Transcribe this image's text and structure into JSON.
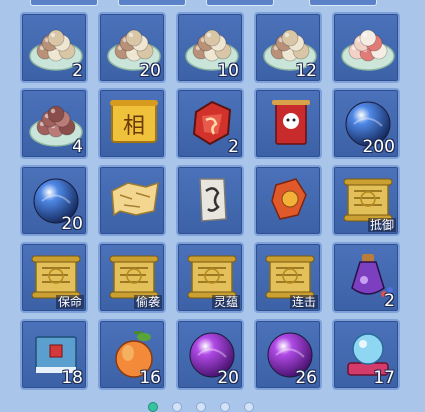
{
  "inventory": {
    "rows": [
      [
        {
          "name": "rice-balls-icon",
          "count": "2",
          "tag": ""
        },
        {
          "name": "rice-balls-icon",
          "count": "20",
          "tag": ""
        },
        {
          "name": "rice-balls-icon",
          "count": "10",
          "tag": ""
        },
        {
          "name": "rice-balls-icon",
          "count": "12",
          "tag": ""
        },
        {
          "name": "pink-rice-balls-icon",
          "count": "",
          "tag": ""
        }
      ],
      [
        {
          "name": "red-rice-balls-icon",
          "count": "4",
          "tag": ""
        },
        {
          "name": "golden-scroll-icon",
          "count": "",
          "tag": "",
          "glyph": "相"
        },
        {
          "name": "red-gem-icon",
          "count": "2",
          "tag": ""
        },
        {
          "name": "red-banner-icon",
          "count": "",
          "tag": ""
        },
        {
          "name": "blue-orb-icon",
          "count": "200",
          "tag": ""
        }
      ],
      [
        {
          "name": "blue-orb-icon",
          "count": "20",
          "tag": ""
        },
        {
          "name": "map-fragment-icon",
          "count": "",
          "tag": ""
        },
        {
          "name": "talisman-icon",
          "count": "",
          "tag": ""
        },
        {
          "name": "red-ornament-icon",
          "count": "",
          "tag": ""
        },
        {
          "name": "skill-scroll-icon",
          "count": "",
          "tag": "抵御"
        }
      ],
      [
        {
          "name": "skill-scroll-icon",
          "count": "",
          "tag": "保命"
        },
        {
          "name": "skill-scroll-icon",
          "count": "",
          "tag": "偷袭"
        },
        {
          "name": "skill-scroll-icon",
          "count": "",
          "tag": "灵蕴"
        },
        {
          "name": "skill-scroll-icon",
          "count": "",
          "tag": "连击"
        },
        {
          "name": "potion-bottle-icon",
          "count": "2",
          "tag": ""
        }
      ],
      [
        {
          "name": "book-icon",
          "count": "18",
          "tag": ""
        },
        {
          "name": "peach-icon",
          "count": "16",
          "tag": ""
        },
        {
          "name": "purple-orb-icon",
          "count": "20",
          "tag": ""
        },
        {
          "name": "purple-orb-icon",
          "count": "26",
          "tag": ""
        },
        {
          "name": "crystal-ball-icon",
          "count": "17",
          "tag": ""
        }
      ]
    ]
  },
  "pagination": {
    "total": 5,
    "active_index": 0
  },
  "colors": {
    "slot_bg": "#4b72ba",
    "slot_border": "#7fa1da",
    "page_bg": "#a9c6ea",
    "active_dot": "#38c3a0"
  }
}
